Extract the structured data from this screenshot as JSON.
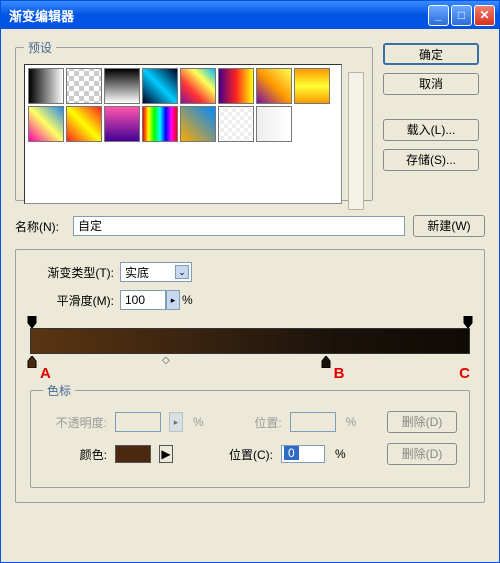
{
  "window": {
    "title": "渐变编辑器"
  },
  "presets": {
    "legend": "预设",
    "swatches": [
      "linear-gradient(to right,#000,#fff)",
      "repeating-conic-gradient(#ccc 0% 25%,#fff 0% 50%) 50%/10px 10px",
      "linear-gradient(to bottom,#000,#fff)",
      "linear-gradient(45deg,#002,#0cf,#002)",
      "linear-gradient(45deg,#819,#f33,#ff5,#0bf)",
      "linear-gradient(to right,#408,#f22,#ff0)",
      "linear-gradient(45deg,#71a,#f90,#ff5)",
      "linear-gradient(to bottom,#f90,#ff3,#f90)",
      "linear-gradient(45deg,#f0a,#ff6,#28e)",
      "linear-gradient(45deg,#f22,#ff0,#f22)",
      "linear-gradient(to bottom,#f5a,#409)",
      "linear-gradient(to right,#f00,#ff0,#0f0,#0ff,#00f,#f0f,#f00)",
      "linear-gradient(45deg,#fa0,#08f)",
      "repeating-conic-gradient(#eee 0% 25%,#fff 0% 50%) 50%/8px 8px",
      "linear-gradient(to right,#eee,#fff)"
    ]
  },
  "buttons": {
    "ok": "确定",
    "cancel": "取消",
    "load": "载入(L)...",
    "save": "存储(S)...",
    "new": "新建(W)",
    "delete1": "删除(D)",
    "delete2": "删除(D)"
  },
  "name": {
    "label": "名称(N):",
    "value": "自定"
  },
  "gradientType": {
    "label": "渐变类型(T):",
    "value": "实底"
  },
  "smoothness": {
    "label": "平滑度(M):",
    "value": "100",
    "unit": "%"
  },
  "markers": {
    "a": "A",
    "b": "B",
    "c": "C"
  },
  "stops": {
    "legend": "色标",
    "opacity": {
      "label": "不透明度:",
      "unit": "%"
    },
    "position1": {
      "label": "位置:",
      "unit": "%"
    },
    "color": {
      "label": "颜色:",
      "hex": "#4A2910"
    },
    "position2": {
      "label": "位置(C):",
      "value": "0",
      "unit": "%"
    }
  }
}
